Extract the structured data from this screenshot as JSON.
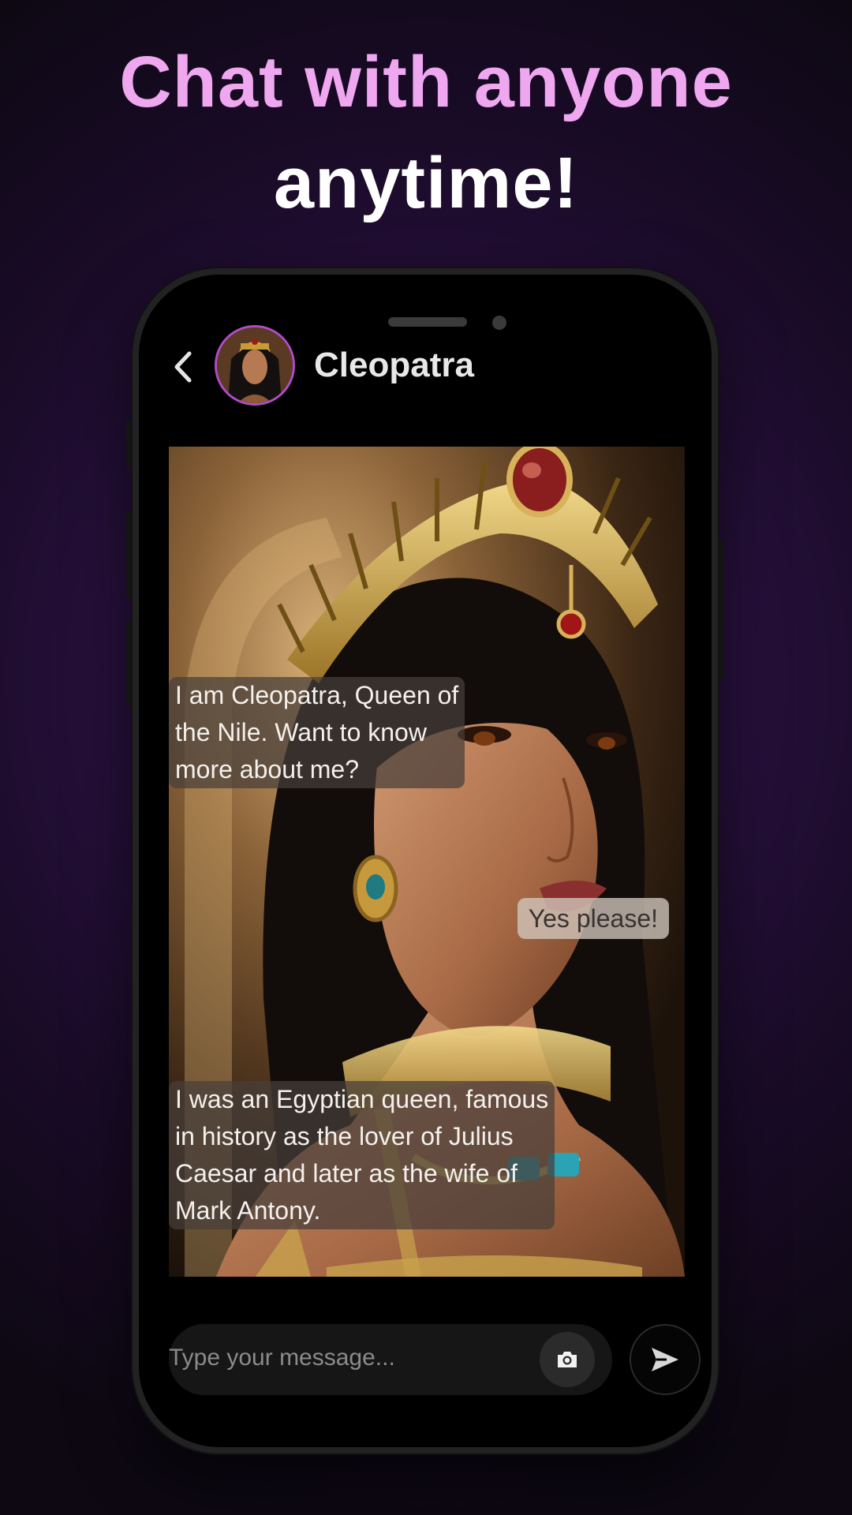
{
  "headline": {
    "line1": "Chat with anyone",
    "line2": "anytime!"
  },
  "colors": {
    "headline_accent": "#efa7f0",
    "avatar_ring": "#b04cc9",
    "background_purple": "#2a1140"
  },
  "chat": {
    "contact_name": "Cleopatra",
    "back_icon": "chevron-left-icon",
    "messages": [
      {
        "sender": "bot",
        "lines": [
          "I am Cleopatra, Queen of",
          "the Nile. Want to know",
          "more about me?"
        ]
      },
      {
        "sender": "user",
        "lines": [
          "Yes please!"
        ]
      },
      {
        "sender": "bot",
        "lines": [
          "I was an Egyptian queen, famous",
          "in history as the lover of Julius",
          "Caesar and later as the wife of",
          "Mark Antony."
        ]
      }
    ]
  },
  "composer": {
    "placeholder": "Type your message...",
    "camera_icon": "camera-icon",
    "send_icon": "send-icon"
  }
}
